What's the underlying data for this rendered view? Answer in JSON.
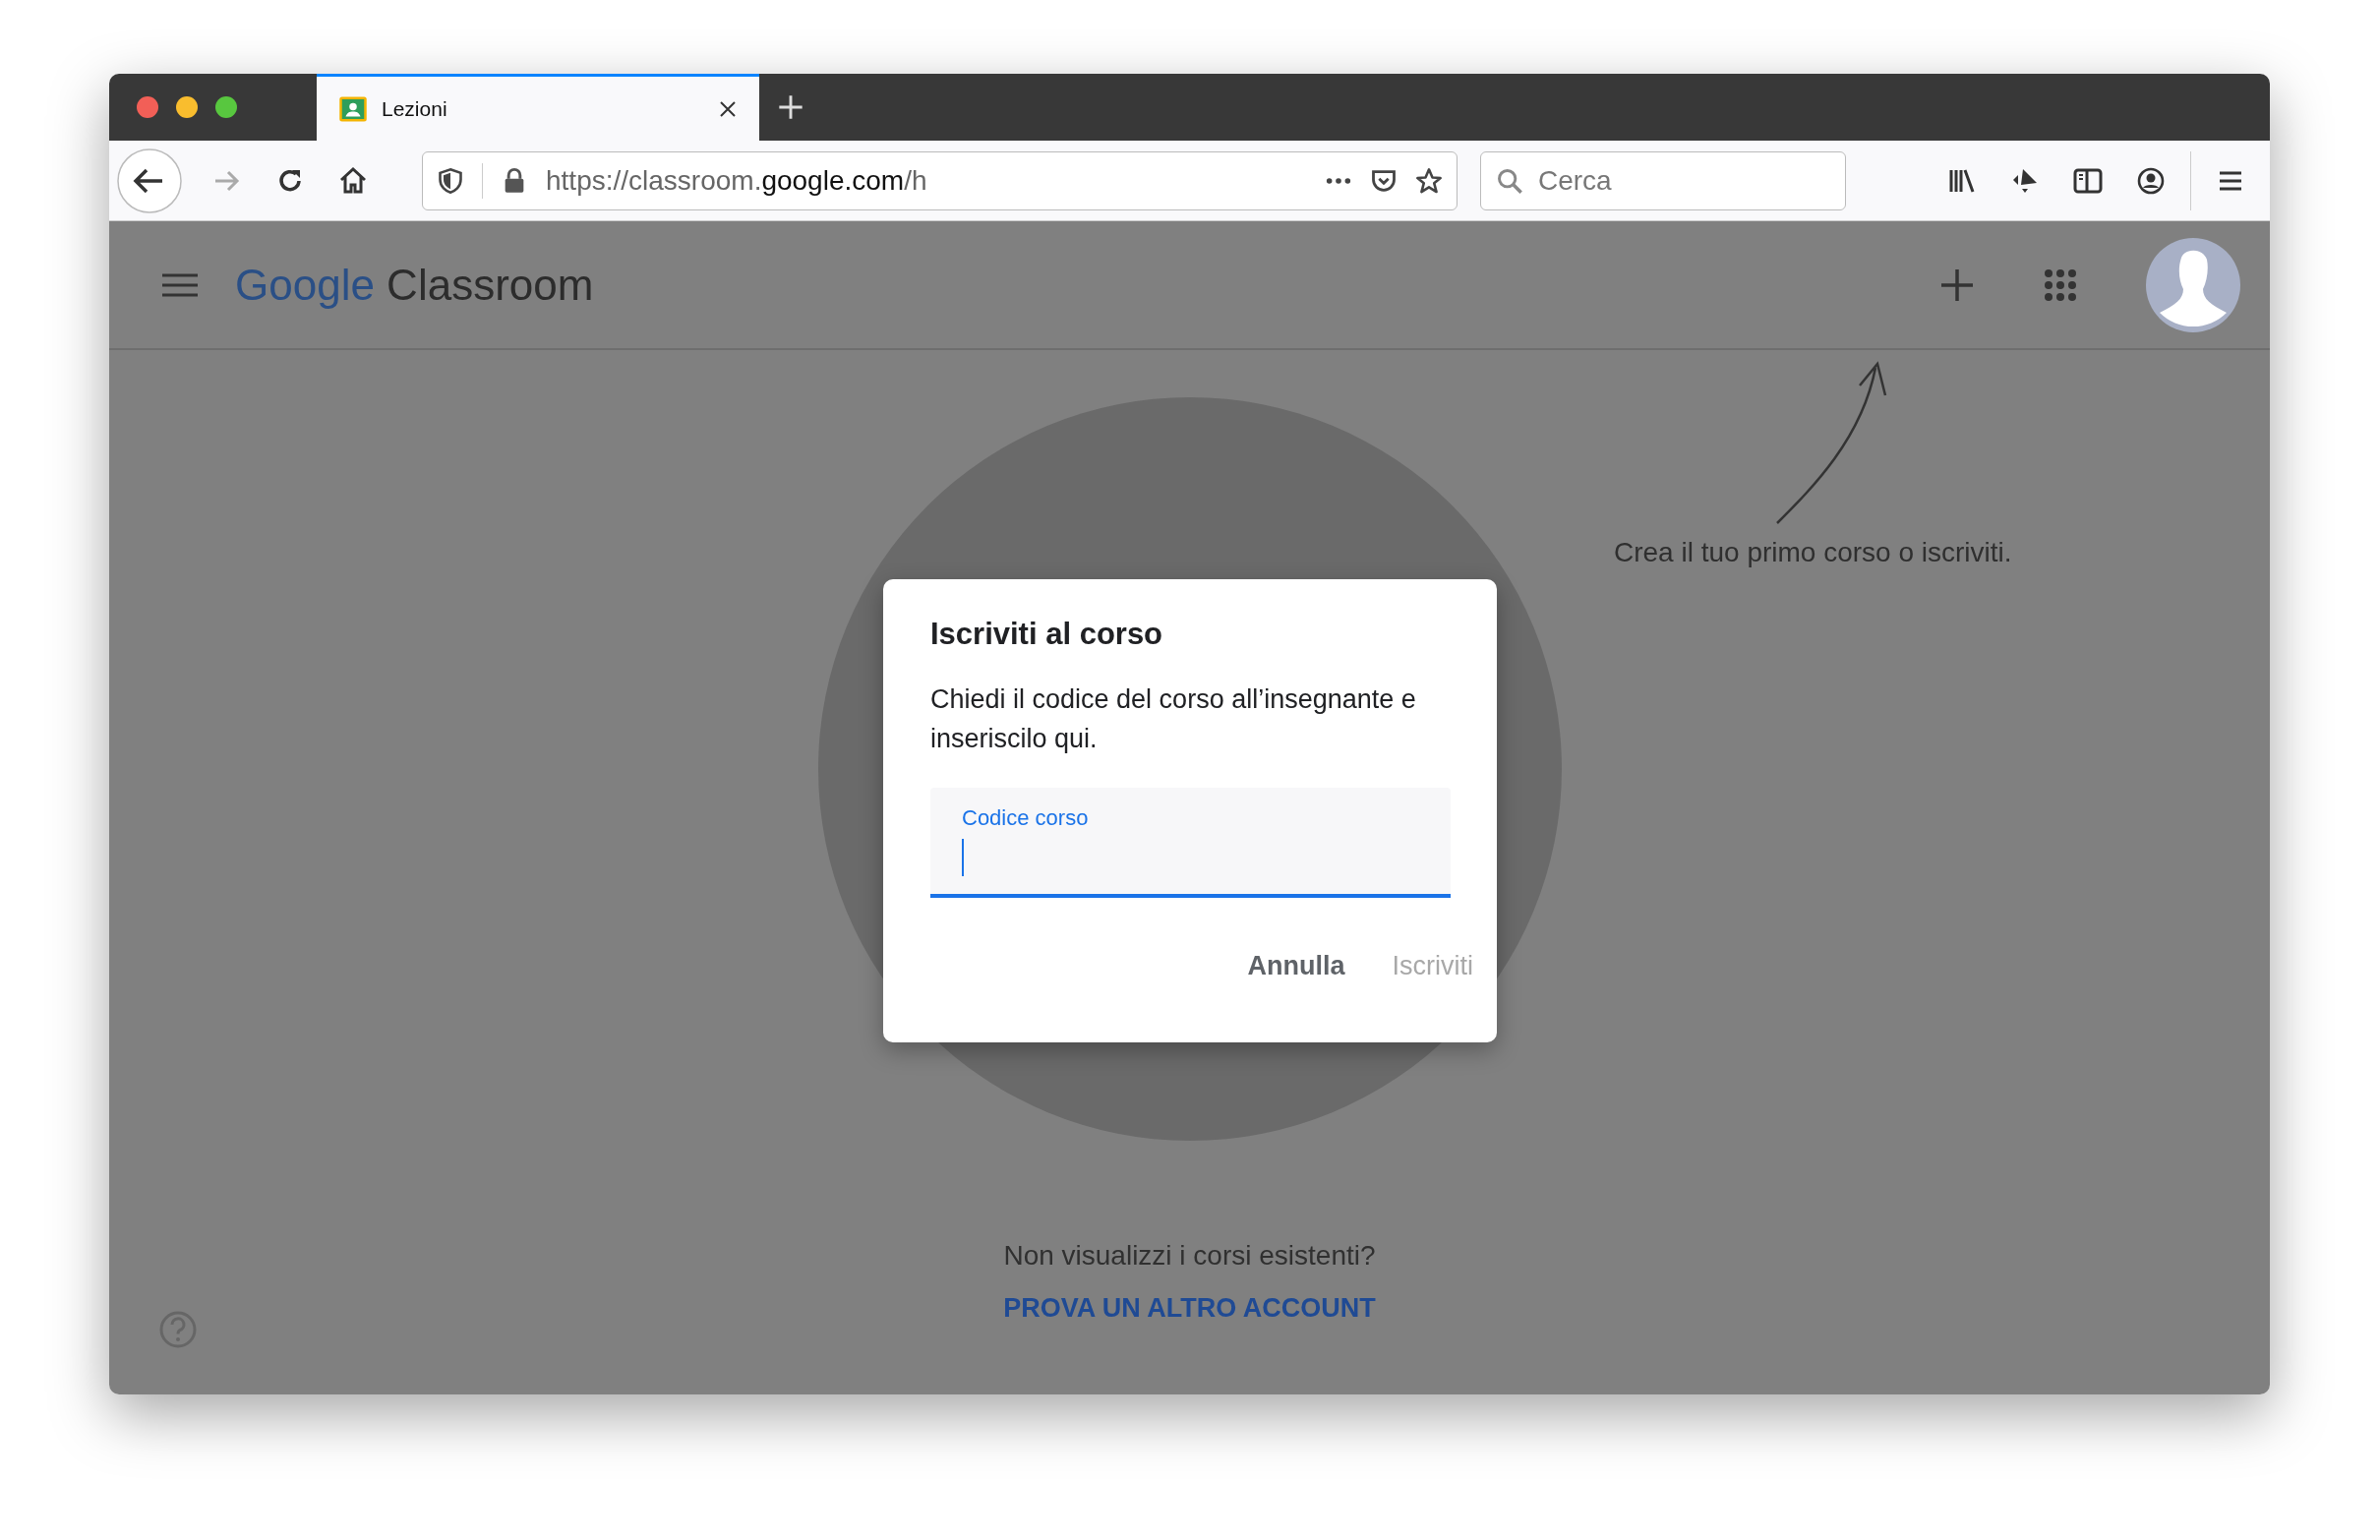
{
  "browser": {
    "tab": {
      "title": "Lezioni",
      "selected": true
    },
    "url": {
      "prefix": "https://classroom.",
      "domain": "google.com",
      "path": "/h"
    },
    "search": {
      "placeholder": "Cerca"
    }
  },
  "app": {
    "logo": {
      "brand": "Google",
      "product": "Classroom"
    }
  },
  "hint": "Crea il tuo primo corso o iscriviti.",
  "dialog": {
    "title": "Iscriviti al corso",
    "message": "Chiedi il codice del corso all’insegnante e inseriscilo qui.",
    "field": {
      "label": "Codice corso",
      "focused": true
    },
    "buttons": [
      {
        "label": "Annulla",
        "disabled": false
      },
      {
        "label": "Iscriviti",
        "disabled": true
      }
    ]
  },
  "footer": {
    "question": "Non visualizzi i corsi esistenti?",
    "link": "PROVA UN ALTRO ACCOUNT"
  }
}
